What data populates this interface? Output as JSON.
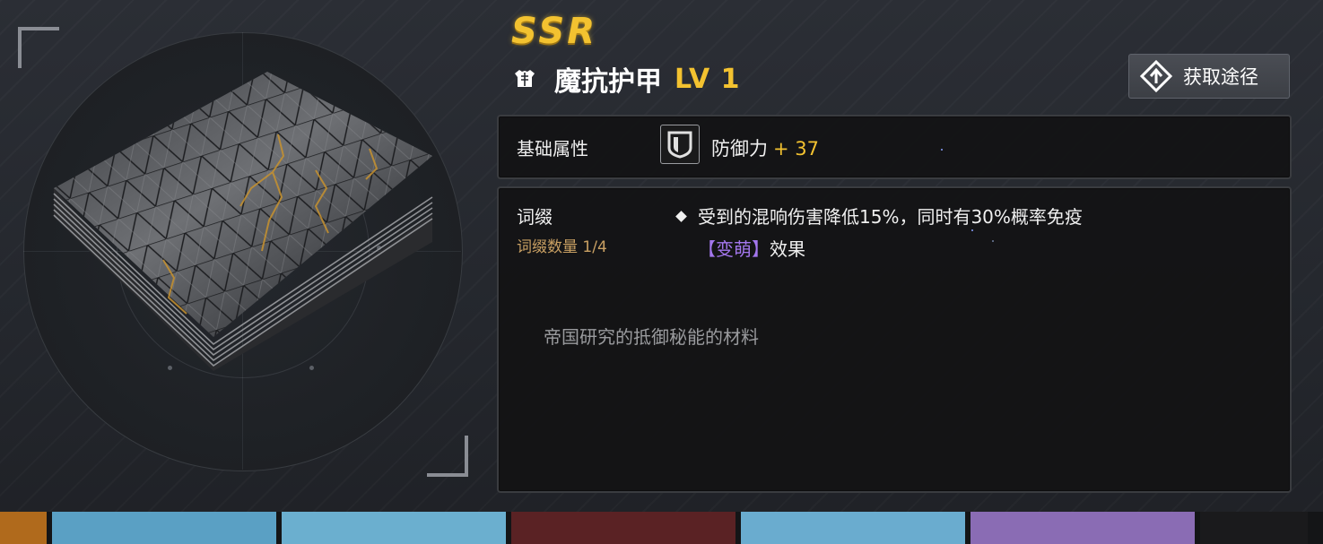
{
  "item": {
    "rarity": "SSR",
    "name": "魔抗护甲",
    "level": "LV 1",
    "description": "帝国研究的抵御秘能的材料"
  },
  "acquire_button": {
    "label": "获取途径"
  },
  "base_attributes": {
    "label": "基础属性",
    "stat_name": "防御力",
    "stat_value": "+ 37"
  },
  "affix": {
    "label": "词缀",
    "count": "词缀数量 1/4",
    "effect_line1": "受到的混响伤害降低15%，同时有30%概率免疫",
    "status_tag": "【变萌】",
    "effect_line2_suffix": "效果"
  },
  "colors": {
    "gold": "#f3c230",
    "purple": "#a477ee",
    "affix_count": "#c9a063"
  },
  "thumbnails": [
    {
      "name": "thumb-orange",
      "color": "#b06a1c"
    },
    {
      "name": "thumb-blue-1",
      "color": "#5aa0c4"
    },
    {
      "name": "thumb-blue-2",
      "color": "#6bafcf"
    },
    {
      "name": "thumb-red",
      "color": "#5a2224"
    },
    {
      "name": "thumb-blue-3",
      "color": "#6aaccf"
    },
    {
      "name": "thumb-purple",
      "color": "#8a6cb4"
    },
    {
      "name": "thumb-dark",
      "color": "#1a1a1c"
    }
  ]
}
